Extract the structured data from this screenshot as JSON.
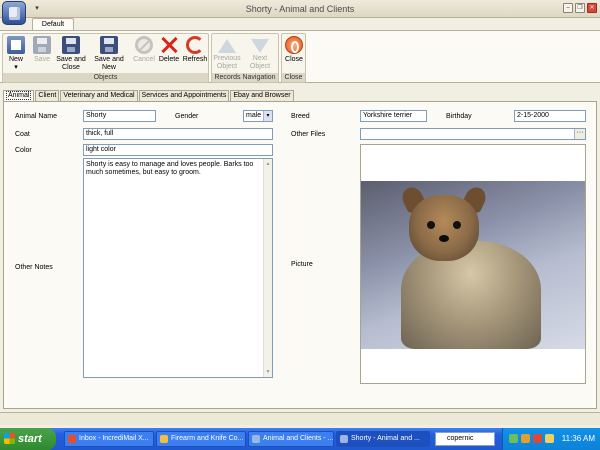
{
  "window": {
    "title": "Shorty - Animal and Clients"
  },
  "ribbon": {
    "tab": "Default",
    "groups": {
      "objects": {
        "label": "Objects",
        "new": "New",
        "save": "Save",
        "save_and_close": [
          "Save and",
          "Close"
        ],
        "save_and_new": "Save and New",
        "cancel": "Cancel",
        "delete": "Delete",
        "refresh": "Refresh"
      },
      "navigation": {
        "label": "Records Navigation",
        "previous": [
          "Previous",
          "Object"
        ],
        "next": "Next Object"
      },
      "close": {
        "label": "Close",
        "close": "Close"
      }
    }
  },
  "tabs": [
    "Animal",
    "Client",
    "Veterinary and Medical",
    "Services and Appointments",
    "Ebay and Browser"
  ],
  "form": {
    "animal_name": {
      "label": "Animal Name",
      "value": "Shorty"
    },
    "gender": {
      "label": "Gender",
      "value": "male"
    },
    "coat": {
      "label": "Coat",
      "value": "thick, full"
    },
    "color": {
      "label": "Color",
      "value": "light color"
    },
    "other_notes": {
      "label": "Other Notes",
      "value": "Shorty is easy to manage and loves people.  Barks too much sometimes, but easy to groom."
    },
    "breed": {
      "label": "Breed",
      "value": "Yorkshire terrier"
    },
    "birthday": {
      "label": "Birthday",
      "value": "2-15-2000"
    },
    "other_files": {
      "label": "Other Files",
      "value": ""
    },
    "picture": {
      "label": "Picture"
    }
  },
  "taskbar": {
    "start": "start",
    "items": [
      "Inbox - IncrediMail X...",
      "Firearm and Knife Co...",
      "Animal and Clients - ...",
      "Shorty - Animal and ..."
    ],
    "search": "copernic",
    "clock": "11:36 AM"
  }
}
